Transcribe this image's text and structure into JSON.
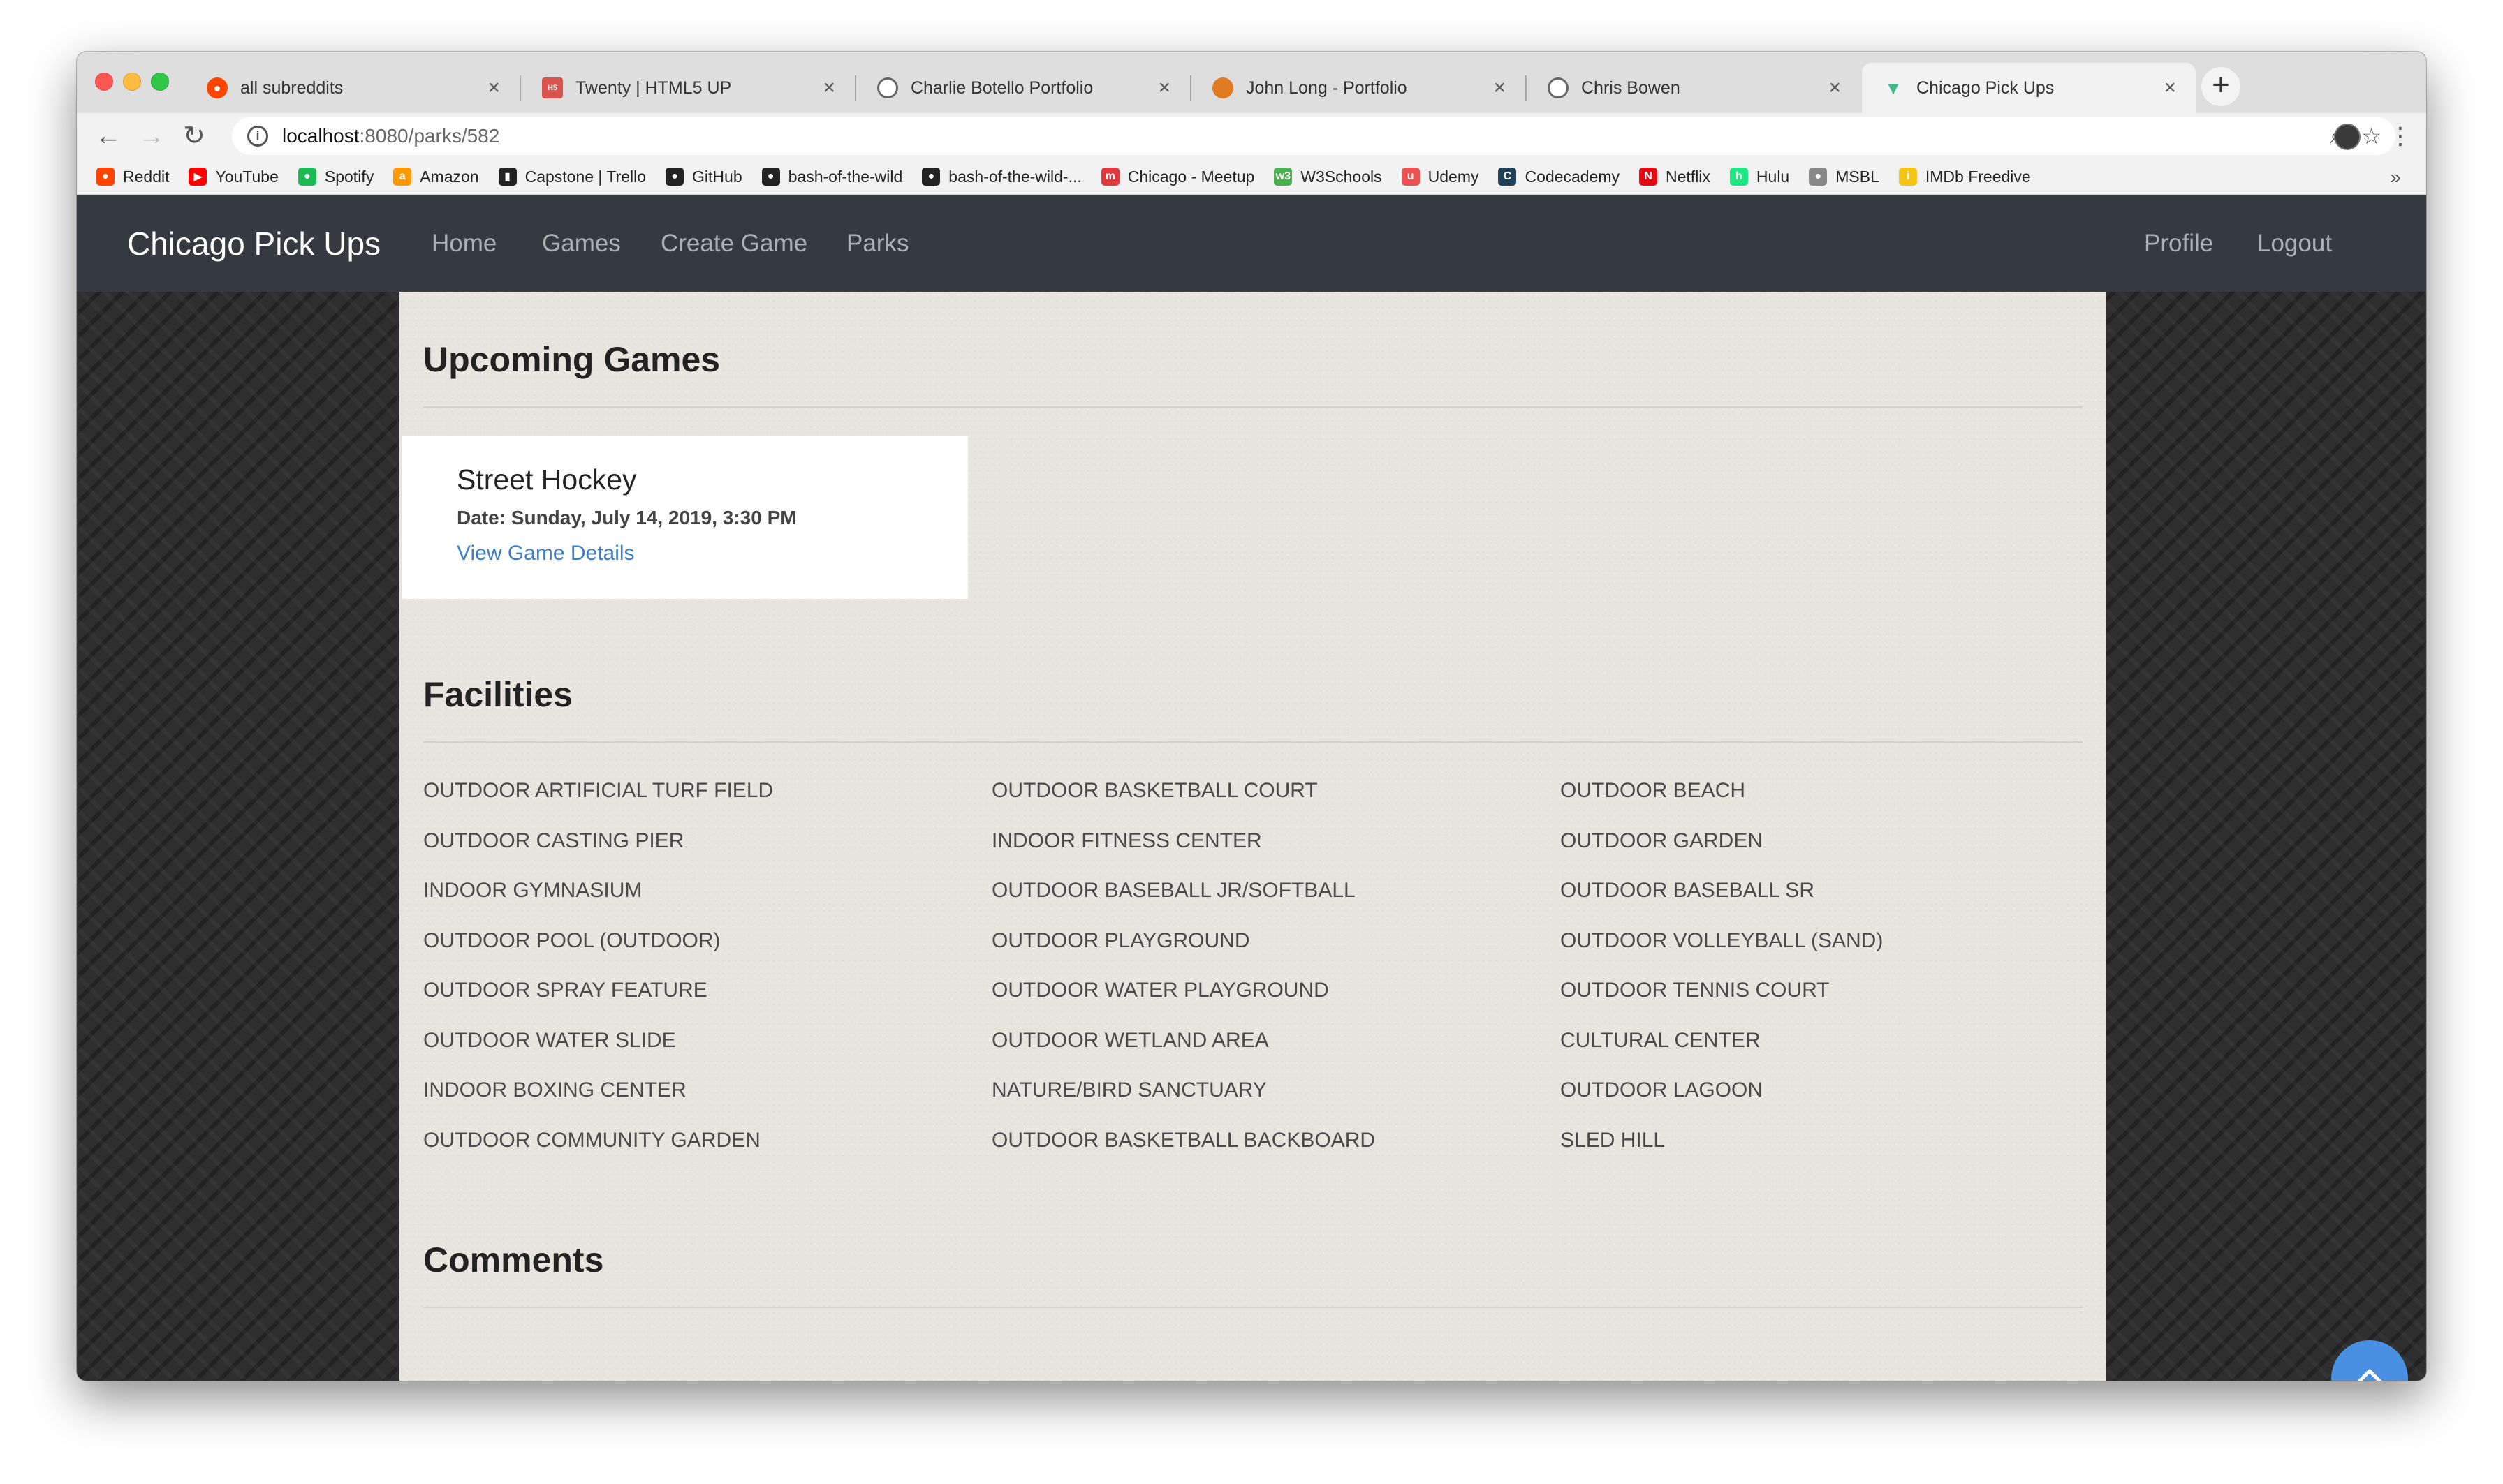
{
  "browser": {
    "tabs": [
      {
        "title": "all subreddits",
        "favicon": "reddit-icon",
        "active": false
      },
      {
        "title": "Twenty | HTML5 UP",
        "favicon": "html5up-icon",
        "active": false
      },
      {
        "title": "Charlie Botello Portfolio",
        "favicon": "globe-icon",
        "active": false
      },
      {
        "title": "John Long - Portfolio",
        "favicon": "basketball-icon",
        "active": false
      },
      {
        "title": "Chris Bowen",
        "favicon": "globe-icon",
        "active": false
      },
      {
        "title": "Chicago Pick Ups",
        "favicon": "vue-icon",
        "active": true
      }
    ],
    "tab_close": "×",
    "new_tab": "+",
    "url_host": "localhost",
    "url_path": ":8080/parks/582",
    "bookmarks": [
      {
        "label": "Reddit",
        "icon": "reddit-icon",
        "color": "#ff4500"
      },
      {
        "label": "YouTube",
        "icon": "youtube-icon",
        "color": "#ff0000"
      },
      {
        "label": "Spotify",
        "icon": "spotify-icon",
        "color": "#1db954"
      },
      {
        "label": "Amazon",
        "icon": "amazon-icon",
        "color": "#ff9900"
      },
      {
        "label": "Capstone | Trello",
        "icon": "trello-icon",
        "color": "#222222"
      },
      {
        "label": "GitHub",
        "icon": "github-icon",
        "color": "#222222"
      },
      {
        "label": "bash-of-the-wild",
        "icon": "github-icon",
        "color": "#222222"
      },
      {
        "label": "bash-of-the-wild-...",
        "icon": "github-icon",
        "color": "#222222"
      },
      {
        "label": "Chicago - Meetup",
        "icon": "meetup-icon",
        "color": "#e0393e"
      },
      {
        "label": "W3Schools",
        "icon": "w3schools-icon",
        "color": "#4caf50"
      },
      {
        "label": "Udemy",
        "icon": "udemy-icon",
        "color": "#ec5252"
      },
      {
        "label": "Codecademy",
        "icon": "codecademy-icon",
        "color": "#1f4056"
      },
      {
        "label": "Netflix",
        "icon": "netflix-icon",
        "color": "#e50914"
      },
      {
        "label": "Hulu",
        "icon": "hulu-icon",
        "color": "#1ce783"
      },
      {
        "label": "MSBL",
        "icon": "msbl-icon",
        "color": "#888888"
      },
      {
        "label": "IMDb Freedive",
        "icon": "imdb-icon",
        "color": "#f5c518"
      }
    ],
    "bookmarks_more": "»"
  },
  "site": {
    "brand": "Chicago Pick Ups",
    "nav_left": [
      "Home",
      "Games",
      "Create Game",
      "Parks"
    ],
    "nav_right": [
      "Profile",
      "Logout"
    ]
  },
  "upcoming": {
    "heading": "Upcoming Games",
    "games": [
      {
        "title": "Street Hockey",
        "date": "Date: Sunday, July 14, 2019, 3:30 PM",
        "link": "View Game Details"
      }
    ]
  },
  "facilities": {
    "heading": "Facilities",
    "columns": [
      [
        "OUTDOOR ARTIFICIAL TURF FIELD",
        "OUTDOOR CASTING PIER",
        "INDOOR GYMNASIUM",
        "OUTDOOR POOL (OUTDOOR)",
        "OUTDOOR SPRAY FEATURE",
        "OUTDOOR WATER SLIDE",
        "INDOOR BOXING CENTER",
        "OUTDOOR COMMUNITY GARDEN"
      ],
      [
        "OUTDOOR BASKETBALL COURT",
        "INDOOR FITNESS CENTER",
        "OUTDOOR BASEBALL JR/SOFTBALL",
        "OUTDOOR PLAYGROUND",
        "OUTDOOR WATER PLAYGROUND",
        "OUTDOOR WETLAND AREA",
        "NATURE/BIRD SANCTUARY",
        "OUTDOOR BASKETBALL BACKBOARD"
      ],
      [
        "OUTDOOR BEACH",
        "OUTDOOR GARDEN",
        "OUTDOOR BASEBALL SR",
        "OUTDOOR VOLLEYBALL (SAND)",
        "OUTDOOR TENNIS COURT",
        "CULTURAL CENTER",
        "OUTDOOR LAGOON",
        "SLED HILL"
      ]
    ]
  },
  "comments": {
    "heading": "Comments"
  },
  "colors": {
    "navbar": "#343a40",
    "link": "#3d7fc1",
    "scroll_top": "#4a90e2"
  }
}
